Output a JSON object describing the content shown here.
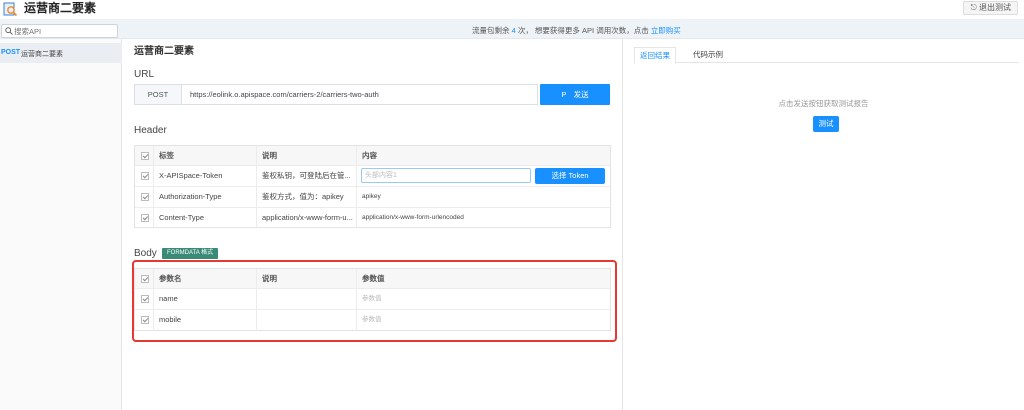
{
  "header": {
    "title": "运营商二要素",
    "logo_icon": "magnifier-logo-icon",
    "exit_label": "退出测试"
  },
  "notice": {
    "prefix": "流量包剩余 ",
    "count": "4",
    "middle": " 次， 想要获得更多 API 调用次数，点击 ",
    "link": "立即购买"
  },
  "search": {
    "placeholder": "搜索API"
  },
  "sidebar": {
    "items": [
      {
        "method": "POST",
        "label": "运营商二要素"
      }
    ]
  },
  "main": {
    "title": "运营商二要素",
    "url_section": {
      "label": "URL",
      "method": "POST",
      "url": "https://eolink.o.apispace.com/carriers-2/carriers-two-auth",
      "send_label": "P　发送"
    },
    "header_section": {
      "label": "Header",
      "columns": [
        "标签",
        "说明",
        "内容"
      ],
      "rows": [
        {
          "tag": "X-APISpace-Token",
          "desc": "鉴权私钥，可登陆后在管...",
          "value_placeholder": "头部内容1",
          "token_button": "选择 Token"
        },
        {
          "tag": "Authorization-Type",
          "desc": "鉴权方式，值为：apikey",
          "value": "apikey"
        },
        {
          "tag": "Content-Type",
          "desc": "application/x-www-form-u...",
          "value": "application/x-www-form-urlencoded"
        }
      ]
    },
    "body_section": {
      "label": "Body",
      "badge": "FORMDATA 格式",
      "columns": [
        "参数名",
        "说明",
        "参数值"
      ],
      "rows": [
        {
          "name": "name",
          "desc": "",
          "value_placeholder": "参数值"
        },
        {
          "name": "mobile",
          "desc": "",
          "value_placeholder": "参数值"
        }
      ]
    }
  },
  "right_panel": {
    "tabs": [
      {
        "label": "返回结果",
        "active": true
      },
      {
        "label": "代码示例",
        "active": false
      }
    ],
    "hint": "点击发送按钮获取测试报告",
    "test_label": "测试"
  },
  "colors": {
    "accent": "#1890ff",
    "badge": "#3a8a78",
    "highlight": "#e53935"
  }
}
